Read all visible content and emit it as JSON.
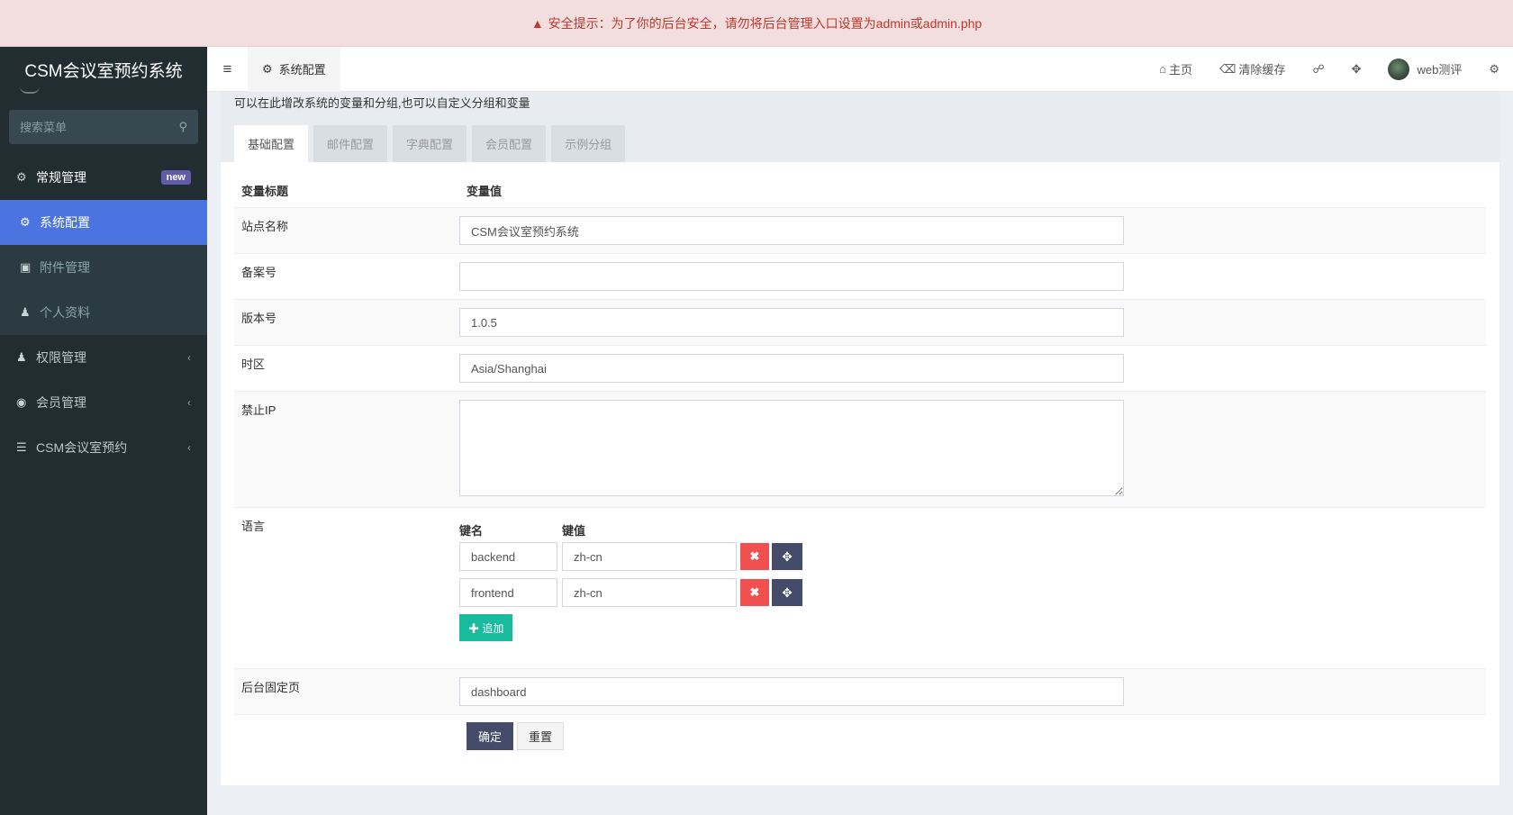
{
  "warning": {
    "icon": "warning-icon",
    "text": "安全提示：为了你的后台安全，请勿将后台管理入口设置为admin或admin.php"
  },
  "sidebar": {
    "logo": "CSM会议室预约系统",
    "search_placeholder": "搜索菜单",
    "menu": {
      "regular": {
        "label": "常规管理",
        "badge": "new",
        "icon": "cogs-icon"
      },
      "sub": [
        {
          "label": "系统配置",
          "icon": "gear-icon",
          "active": true
        },
        {
          "label": "附件管理",
          "icon": "image-icon"
        },
        {
          "label": "个人资料",
          "icon": "user-icon"
        }
      ],
      "auth": {
        "label": "权限管理",
        "icon": "users-icon"
      },
      "member": {
        "label": "会员管理",
        "icon": "user-circle-icon"
      },
      "csm": {
        "label": "CSM会议室预约",
        "icon": "list-icon"
      }
    }
  },
  "header": {
    "tab": "系统配置",
    "home": "主页",
    "clear_cache": "清除缓存",
    "username": "web测评"
  },
  "panel": {
    "description": "可以在此增改系统的变量和分组,也可以自定义分组和变量",
    "tabs": [
      "基础配置",
      "邮件配置",
      "字典配置",
      "会员配置",
      "示例分组"
    ]
  },
  "table": {
    "col_title": "变量标题",
    "col_value": "变量值",
    "site_name_label": "站点名称",
    "site_name_value": "CSM会议室预约系统",
    "beian_label": "备案号",
    "beian_value": "",
    "version_label": "版本号",
    "version_value": "1.0.5",
    "timezone_label": "时区",
    "timezone_value": "Asia/Shanghai",
    "forbidden_ip_label": "禁止IP",
    "forbidden_ip_value": "",
    "language_label": "语言",
    "language_key_header": "键名",
    "language_value_header": "键值",
    "language_rows": [
      {
        "key": "backend",
        "value": "zh-cn"
      },
      {
        "key": "frontend",
        "value": "zh-cn"
      }
    ],
    "add_label": "追加",
    "fixed_page_label": "后台固定页",
    "fixed_page_value": "dashboard"
  },
  "buttons": {
    "ok": "确定",
    "reset": "重置"
  }
}
